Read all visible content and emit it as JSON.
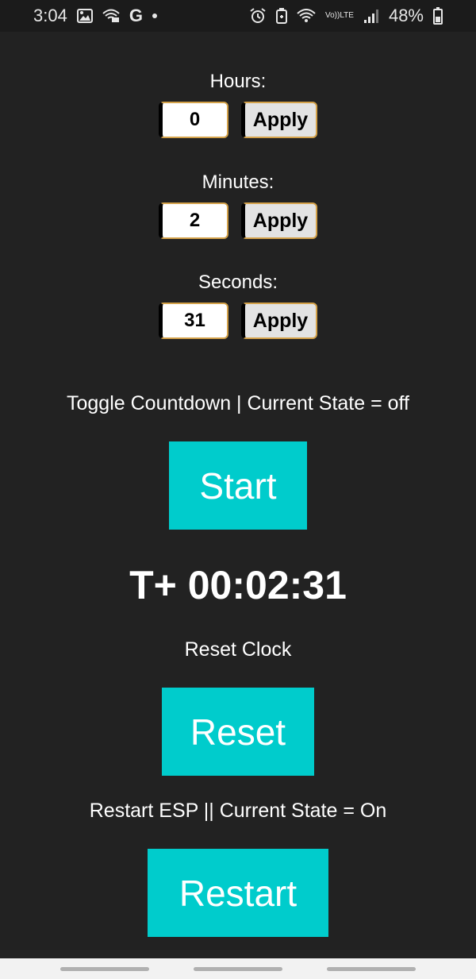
{
  "status_bar": {
    "time": "3:04",
    "battery": "48%",
    "g_label": "G",
    "volte_top": "Vo))",
    "volte_bottom": "LTE"
  },
  "fields": {
    "hours": {
      "label": "Hours:",
      "value": "0",
      "apply_label": "Apply"
    },
    "minutes": {
      "label": "Minutes:",
      "value": "2",
      "apply_label": "Apply"
    },
    "seconds": {
      "label": "Seconds:",
      "value": "31",
      "apply_label": "Apply"
    }
  },
  "countdown": {
    "toggle_text": "Toggle Countdown | Current State = off",
    "start_label": "Start",
    "timer_text": "T+ 00:02:31"
  },
  "reset": {
    "text": "Reset Clock",
    "button_label": "Reset"
  },
  "restart": {
    "text": "Restart ESP || Current State = On",
    "button_label": "Restart"
  },
  "colors": {
    "background": "#222222",
    "accent": "#00cccc",
    "input_border": "#d4a24a"
  },
  "icons": [
    "image-icon",
    "cast-icon",
    "google-icon",
    "alarm-icon",
    "battery-saver-icon",
    "wifi-icon",
    "signal-icon",
    "battery-icon"
  ]
}
